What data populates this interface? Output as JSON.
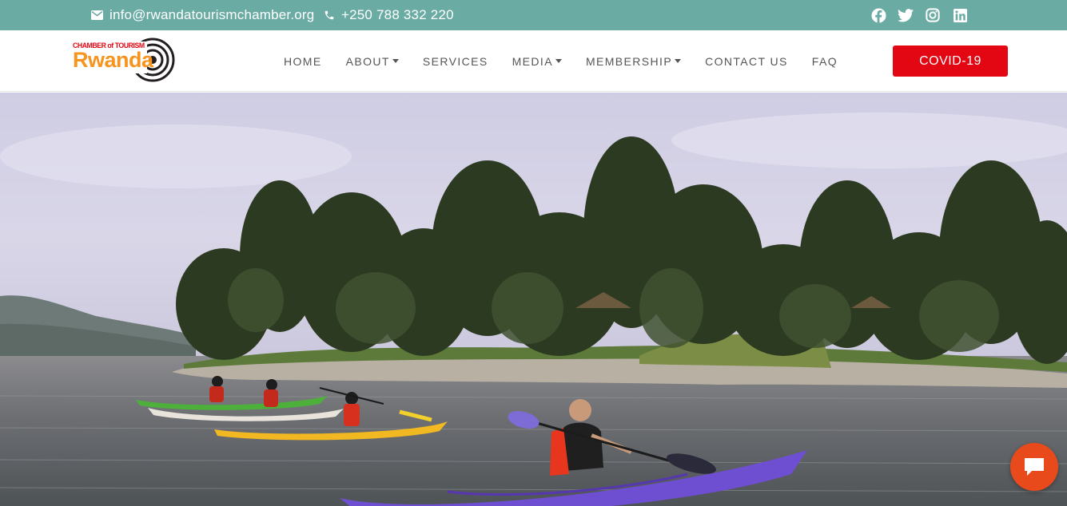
{
  "topbar": {
    "email": "info@rwandatourismchamber.org",
    "phone": "+250 788 332 220",
    "icons": {
      "email": "envelope-icon",
      "phone": "phone-icon"
    },
    "social": [
      "facebook-icon",
      "twitter-icon",
      "instagram-icon",
      "linkedin-icon"
    ]
  },
  "logo": {
    "line1": "CHAMBER of TOURISM",
    "line2": "Rwanda"
  },
  "nav": {
    "items": [
      {
        "label": "HOME",
        "dropdown": false
      },
      {
        "label": "ABOUT",
        "dropdown": true
      },
      {
        "label": "SERVICES",
        "dropdown": false
      },
      {
        "label": "MEDIA",
        "dropdown": true
      },
      {
        "label": "MEMBERSHIP",
        "dropdown": true
      },
      {
        "label": "CONTACT US",
        "dropdown": false
      },
      {
        "label": "FAQ",
        "dropdown": false
      }
    ],
    "cta": "COVID-19"
  },
  "hero": {
    "image": "kayakers-on-lake-kivu-island-photo"
  },
  "chat": {
    "icon": "chat-bubble-icon"
  },
  "colors": {
    "topbar_bg": "#6aaba3",
    "cta_bg": "#e30613",
    "chat_bg": "#e84a1c",
    "logo_orange": "#f7941d",
    "logo_red": "#e30613"
  }
}
